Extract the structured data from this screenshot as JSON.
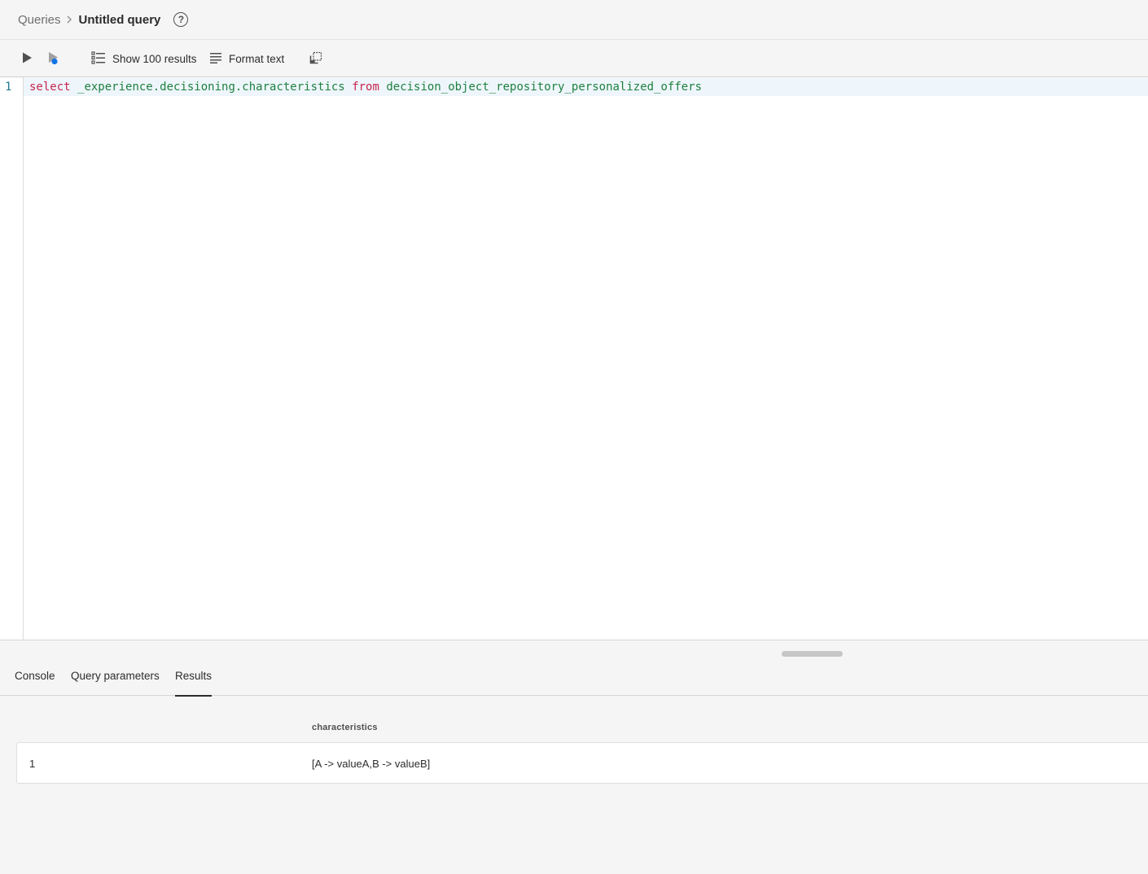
{
  "breadcrumb": {
    "root": "Queries",
    "current": "Untitled query",
    "help_icon": "help-icon"
  },
  "toolbar": {
    "run_icon": "play-icon",
    "run_selected_icon": "play-selection-icon",
    "show_results_label": "Show 100 results",
    "show_results_icon": "list-icon",
    "format_label": "Format text",
    "format_icon": "text-align-icon",
    "copy_icon": "copy-icon"
  },
  "editor": {
    "lines": [
      {
        "number": "1",
        "tokens": [
          {
            "text": "select",
            "type": "keyword"
          },
          {
            "text": " ",
            "type": "space"
          },
          {
            "text": "_experience.decisioning.characteristics",
            "type": "identifier"
          },
          {
            "text": " ",
            "type": "space"
          },
          {
            "text": "from",
            "type": "keyword"
          },
          {
            "text": " ",
            "type": "space"
          },
          {
            "text": "decision_object_repository_personalized_offers",
            "type": "identifier"
          }
        ]
      }
    ],
    "colors": {
      "keyword": "#c7254e",
      "identifier": "#1f8040",
      "line_number": "#237893"
    }
  },
  "panel": {
    "tabs": [
      {
        "label": "Console",
        "selected": false
      },
      {
        "label": "Query parameters",
        "selected": false
      },
      {
        "label": "Results",
        "selected": true
      }
    ],
    "results": {
      "columns": [
        "characteristics"
      ],
      "rows": [
        {
          "index": "1",
          "values": [
            "[A -> valueA,B -> valueB]"
          ]
        }
      ]
    }
  }
}
